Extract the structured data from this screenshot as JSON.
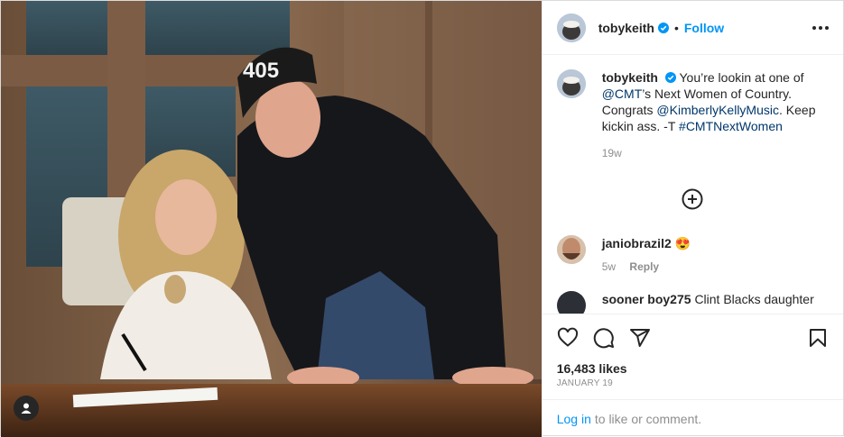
{
  "post": {
    "author": "tobykeith",
    "follow_label": "Follow",
    "separator": "•",
    "caption": {
      "username": "tobykeith",
      "text_1": "You’re lookin at one of ",
      "mention_1": "@CMT",
      "text_2": "’s Next Women of Country. Congrats ",
      "mention_2": "@KimberlyKellyMusic",
      "text_3": ". Keep kickin ass. -T ",
      "hashtag": "#CMTNextWomen",
      "age": "19w"
    },
    "comments": [
      {
        "username": "janiobrazil2",
        "text": "😍",
        "age": "5w",
        "reply_label": "Reply"
      },
      {
        "username": "sooner boy275",
        "text": "Clint Blacks daughter",
        "age": "",
        "reply_label": ""
      }
    ],
    "likes": "16,483 likes",
    "date": "JANUARY 19",
    "login_link": "Log in",
    "login_text": "to like or comment.",
    "hat_text": "405"
  },
  "colors": {
    "accent": "#0095f6",
    "link": "#00376b",
    "muted": "#8e8e8e",
    "verified": "#0095f6"
  },
  "icons": [
    "verified-badge-icon",
    "more-options-icon",
    "load-more-plus-icon",
    "heart-icon",
    "comment-icon",
    "share-icon",
    "save-icon",
    "user-tag-icon"
  ]
}
